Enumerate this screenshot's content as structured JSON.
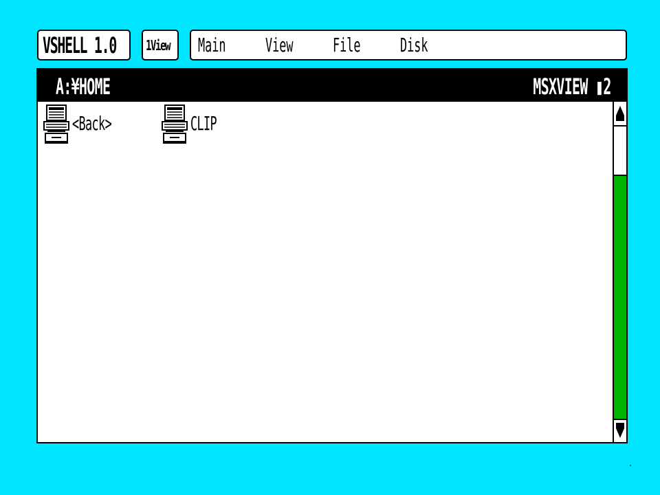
{
  "header": {
    "app_title": "VSHELL 1.0",
    "view_button": "1View",
    "menu": [
      "Main",
      "View",
      "File",
      "Disk"
    ]
  },
  "window": {
    "path": "A:¥HOME",
    "app_name": "MSXVIEW ▮2",
    "files": [
      {
        "label": "<Back>",
        "icon": "computer-icon"
      },
      {
        "label": "CLIP",
        "icon": "computer-icon"
      }
    ]
  },
  "scrollbar": {
    "up_icon": "arrow-up-icon",
    "down_icon": "arrow-down-icon",
    "position": 0.0
  },
  "colors": {
    "desktop": "#00e5ff",
    "track": "#00b300",
    "titlebar": "#000000"
  }
}
